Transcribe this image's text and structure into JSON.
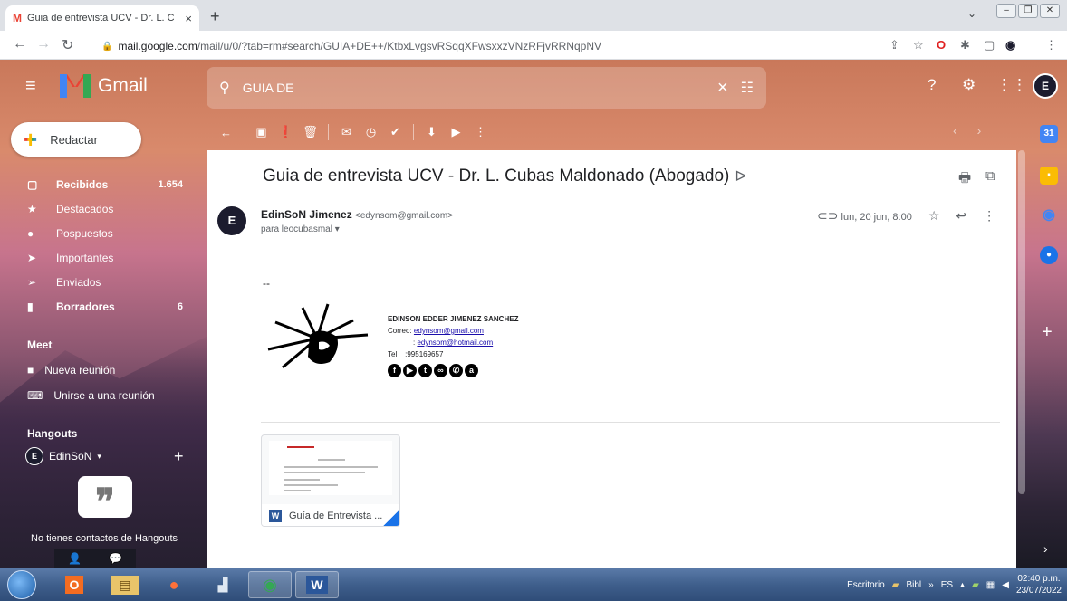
{
  "browser": {
    "tab_title": "Guia de entrevista UCV - Dr. L. C",
    "tab_close": "×",
    "new_tab": "+",
    "url_host": "mail.google.com",
    "url_path": "/mail/u/0/?tab=rm#search/GUIA+DE++/KtbxLvgsvRSqqXFwsxxzVNzRFjvRRNqpNV"
  },
  "gmail": {
    "app_name": "Gmail",
    "search_value": "GUIA DE",
    "compose_label": "Redactar",
    "avatar_letter": "E",
    "nav": [
      {
        "label": "Recibidos",
        "count": "1.654",
        "bold": true,
        "icon": "inbox-icon"
      },
      {
        "label": "Destacados",
        "count": "",
        "bold": false,
        "icon": "star-icon"
      },
      {
        "label": "Pospuestos",
        "count": "",
        "bold": false,
        "icon": "clock-icon"
      },
      {
        "label": "Importantes",
        "count": "",
        "bold": false,
        "icon": "important-icon"
      },
      {
        "label": "Enviados",
        "count": "",
        "bold": false,
        "icon": "send-icon"
      },
      {
        "label": "Borradores",
        "count": "6",
        "bold": true,
        "icon": "draft-icon"
      }
    ],
    "meet": {
      "title": "Meet",
      "new_meeting": "Nueva reunión",
      "join_meeting": "Unirse a una reunión"
    },
    "hangouts": {
      "title": "Hangouts",
      "user": "EdinSoN",
      "no_contacts": "No tienes contactos de Hangouts"
    }
  },
  "message": {
    "subject": "Guia de entrevista UCV - Dr. L. Cubas Maldonado (Abogado)",
    "sender_name": "EdinSoN Jimenez",
    "sender_email": "<edynsom@gmail.com>",
    "recipient": "para leocubasmal",
    "date": "lun, 20 jun, 8:00",
    "body_dashes": "--",
    "signature": {
      "name": "EDINSON EDDER JIMENEZ SANCHEZ",
      "correo_label": "Correo:",
      "email1": "edynsom@gmail.com",
      "email2": "edynsom@hotmail.com",
      "tel_label": "Tel",
      "tel": ":995169657"
    },
    "attachment": {
      "name": "Guía de Entrevista ...",
      "type_letter": "W"
    }
  },
  "taskbar": {
    "desktop_label": "Escritorio",
    "bibl_label": "Bibl",
    "lang": "ES",
    "time": "02:40 p.m.",
    "date": "23/07/2022"
  },
  "colors": {
    "gmail_red": "#ea4335",
    "gmail_yellow": "#fbbc04",
    "gmail_green": "#34a853",
    "gmail_blue": "#4285f4",
    "link": "#1a0dab"
  }
}
